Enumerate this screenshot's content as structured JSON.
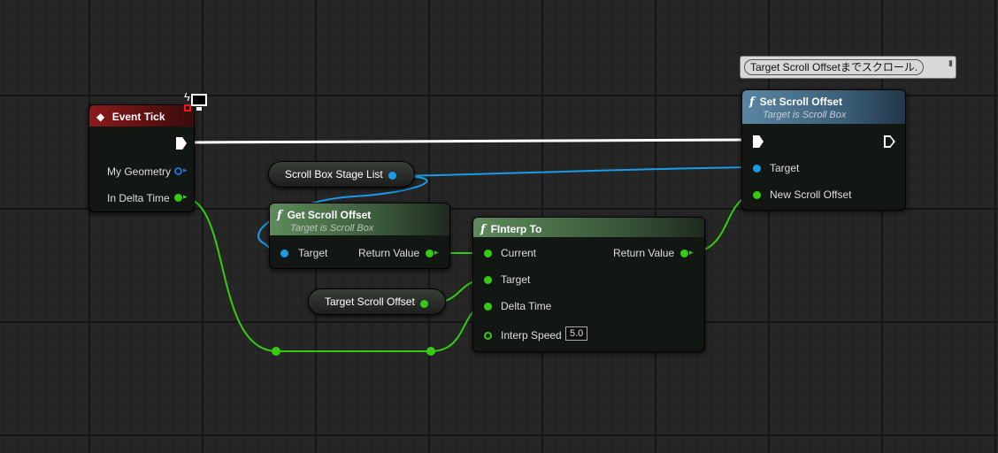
{
  "comment": {
    "text": "Target Scroll Offsetまでスクロール."
  },
  "event_tick": {
    "title": "Event Tick",
    "pins": {
      "my_geometry": "My Geometry",
      "in_delta_time": "In Delta Time"
    }
  },
  "scroll_box_var": {
    "label": "Scroll Box Stage List"
  },
  "get_scroll_offset": {
    "title": "Get Scroll Offset",
    "subtitle": "Target is Scroll Box",
    "pins": {
      "target": "Target",
      "return_value": "Return Value"
    }
  },
  "target_offset_var": {
    "label": "Target Scroll Offset"
  },
  "finterp": {
    "title": "FInterp To",
    "pins": {
      "current": "Current",
      "target": "Target",
      "delta_time": "Delta Time",
      "interp_speed": "Interp Speed",
      "interp_speed_value": "5.0",
      "return_value": "Return Value"
    }
  },
  "set_scroll_offset": {
    "title": "Set Scroll Offset",
    "subtitle": "Target is Scroll Box",
    "pins": {
      "target": "Target",
      "new_scroll_offset": "New Scroll Offset"
    }
  },
  "colors": {
    "exec": "#ffffff",
    "float": "#33cc11",
    "object": "#1a9be6",
    "event_header": "#8b1a1a",
    "pure_header": "#5e8a5c",
    "impure_header": "#5a86a3"
  },
  "icons": {
    "event": "event-diamond-icon",
    "function": "function-f-icon",
    "exec_pin": "exec-arrow-icon",
    "monitor": "client-monitor-icon"
  }
}
